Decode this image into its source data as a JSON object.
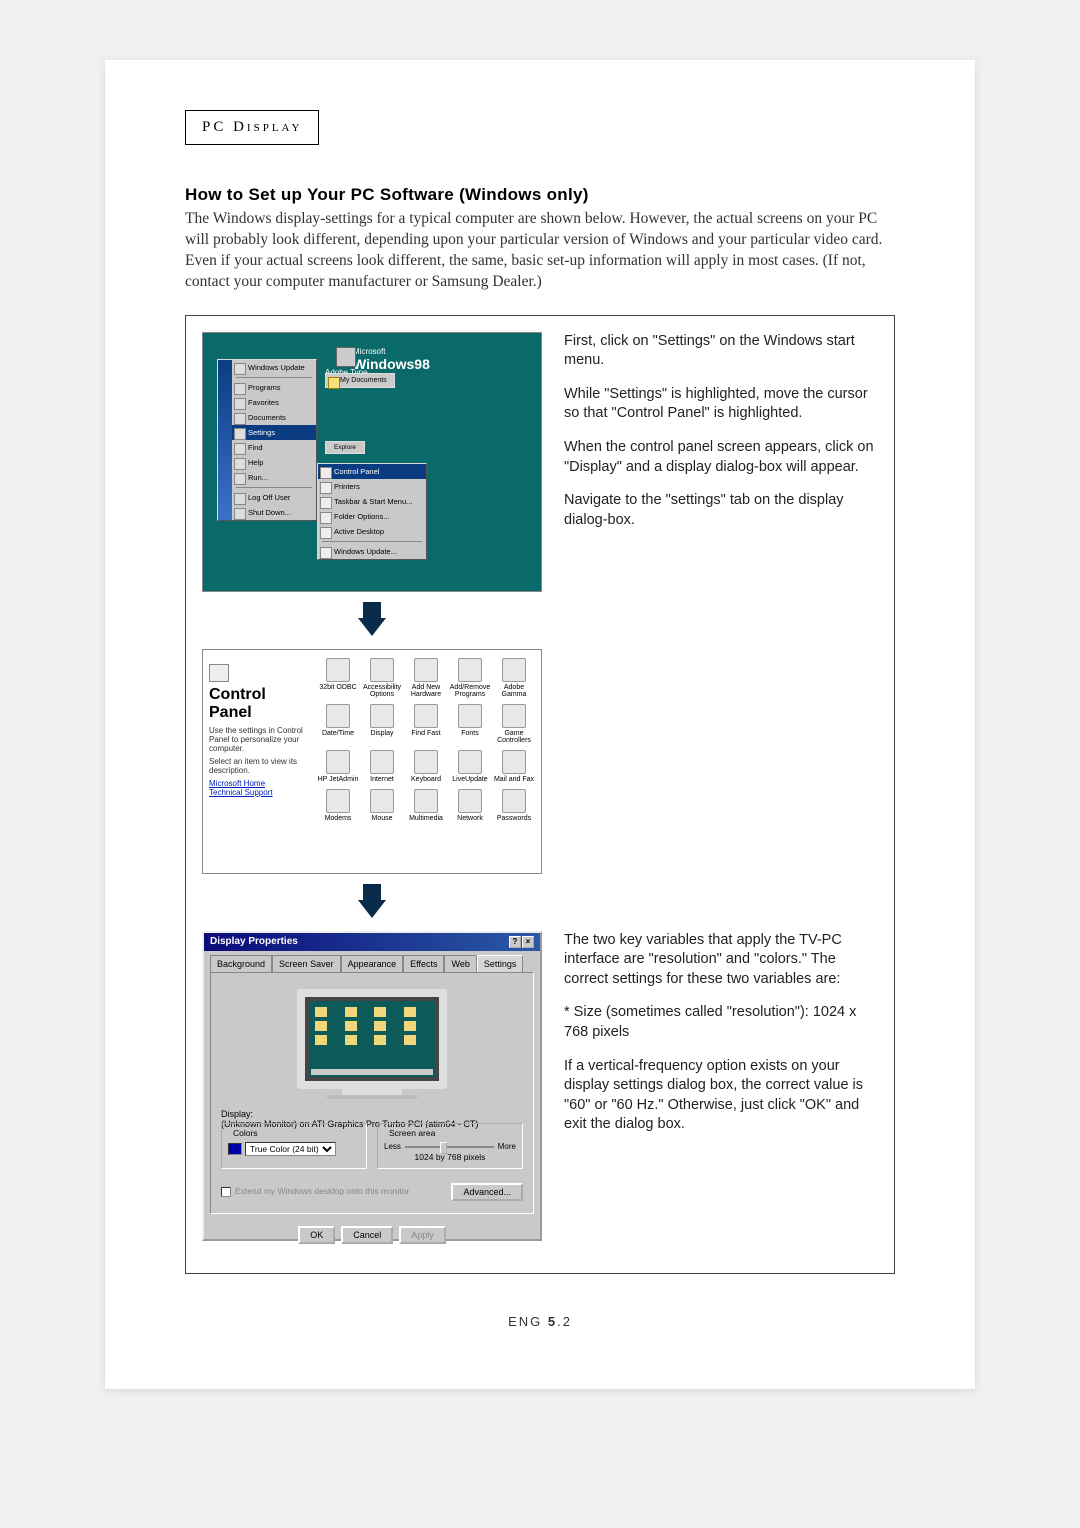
{
  "header": {
    "label": "PC Display"
  },
  "title": "How to Set up Your PC Software (Windows only)",
  "intro": "The Windows display-settings for a typical computer are shown below. However, the actual screens on your PC will probably look different, depending upon your particular version of Windows and your particular video card. Even if your actual screens look different, the same, basic set-up information will apply in most cases. (If not, contact your computer manufacturer or Samsung Dealer.)",
  "side1": {
    "p1": "First, click on \"Settings\" on the Windows start menu.",
    "p2": "While \"Settings\" is highlighted, move the cursor so that \"Control Panel\" is highlighted.",
    "p3": "When the control panel screen appears, click on \"Display\" and a display dialog-box will appear.",
    "p4": "Navigate to the \"settings\" tab on the display dialog-box."
  },
  "side3": {
    "p1": "The two key variables that apply the TV-PC interface are \"resolution\" and \"colors.\" The correct settings for these two variables are:",
    "p2": "* Size (sometimes called \"resolution\"): 1024 x 768 pixels",
    "p3": "If a vertical-frequency option exists on your display settings dialog box, the correct value is \"60\" or \"60 Hz.\" Otherwise, just click \"OK\" and exit the dialog box."
  },
  "startmenu": {
    "brand": "Windows98",
    "brand_prefix": "Microsoft",
    "items": [
      "Windows Update",
      "Programs",
      "Favorites",
      "Documents",
      "Settings",
      "Find",
      "Help",
      "Run...",
      "Log Off User",
      "Shut Down..."
    ],
    "my_documents": "My Documents",
    "explore": "Explore",
    "submenu": [
      "Control Panel",
      "Printers",
      "Taskbar & Start Menu...",
      "Folder Options...",
      "Active Desktop",
      "Windows Update..."
    ]
  },
  "control_panel": {
    "title": "Control Panel",
    "desc1": "Use the settings in Control Panel to personalize your computer.",
    "desc2": "Select an item to view its description.",
    "links": [
      "Microsoft Home",
      "Technical Support"
    ],
    "items": [
      "32bit ODBC",
      "Accessibility Options",
      "Add New Hardware",
      "Add/Remove Programs",
      "Adobe Gamma",
      "Date/Time",
      "Display",
      "Find Fast",
      "Fonts",
      "Game Controllers",
      "HP JetAdmin",
      "Internet",
      "Keyboard",
      "LiveUpdate",
      "Mail and Fax",
      "Modems",
      "Mouse",
      "Multimedia",
      "Network",
      "Passwords"
    ]
  },
  "display_props": {
    "title": "Display Properties",
    "tabs": [
      "Background",
      "Screen Saver",
      "Appearance",
      "Effects",
      "Web",
      "Settings"
    ],
    "display_label": "Display:",
    "display_value": "(Unknown Monitor) on ATI Graphics Pro Turbo PCI (atim64 - CT)",
    "colors_label": "Colors",
    "colors_value": "True Color (24 bit)",
    "area_label": "Screen area",
    "less": "Less",
    "more": "More",
    "res": "1024 by 768 pixels",
    "extend_chk": "Extend my Windows desktop onto this monitor",
    "btn_advanced": "Advanced...",
    "btn_ok": "OK",
    "btn_cancel": "Cancel",
    "btn_apply": "Apply"
  },
  "footer": {
    "prefix": "ENG ",
    "bold": "5",
    "suffix": ".2"
  }
}
